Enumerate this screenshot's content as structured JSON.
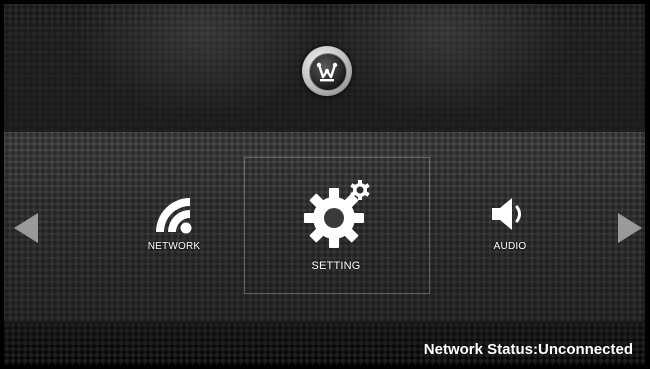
{
  "logo": {
    "name": "westinghouse-logo"
  },
  "menu": {
    "items": [
      {
        "label": "NETWORK",
        "icon": "wifi-icon"
      },
      {
        "label": "SETTING",
        "icon": "gear-icon",
        "selected": true
      },
      {
        "label": "AUDIO",
        "icon": "speaker-icon"
      }
    ]
  },
  "status": {
    "text": "Network Status:Unconnected"
  },
  "colors": {
    "highlight": "#ffffff",
    "arrow": "#9a9a9a"
  }
}
